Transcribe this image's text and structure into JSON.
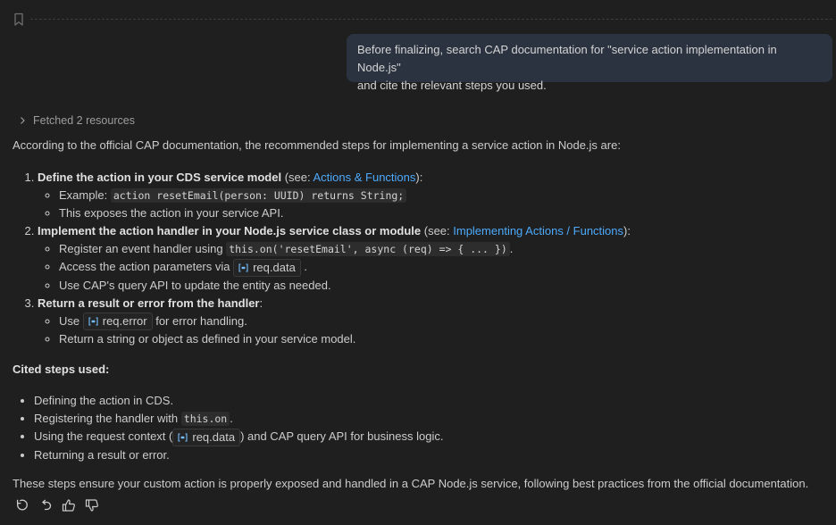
{
  "user_message": {
    "line1": "Before finalizing, search CAP documentation for \"service action implementation in Node.js\"",
    "line2": "and cite the relevant steps you used."
  },
  "fetched": {
    "label": "Fetched 2 resources"
  },
  "response": {
    "intro": "According to the official CAP documentation, the recommended steps for implementing a service action in Node.js are:",
    "step1": {
      "title": "Define the action in your CDS service model",
      "see": " (see: ",
      "link": "Actions & Functions",
      "end": "):",
      "sub1_prefix": "Example: ",
      "sub1_code": "action resetEmail(person: UUID) returns String;",
      "sub2": "This exposes the action in your service API."
    },
    "step2": {
      "title": "Implement the action handler in your Node.js service class or module",
      "see": " (see: ",
      "link": "Implementing Actions / Functions",
      "end": "):",
      "sub1_prefix": "Register an event handler using ",
      "sub1_code": "this.on('resetEmail', async (req) => { ... })",
      "sub1_end": ".",
      "sub2_prefix": "Access the action parameters via ",
      "sub2_sym": "req.data",
      "sub2_end": ".",
      "sub3": "Use CAP's query API to update the entity as needed."
    },
    "step3": {
      "title": "Return a result or error from the handler",
      "end": ":",
      "sub1_prefix": "Use ",
      "sub1_sym": "req.error",
      "sub1_end": " for error handling.",
      "sub2": "Return a string or object as defined in your service model."
    },
    "cited_heading": "Cited steps used:",
    "cited": {
      "item1": "Defining the action in CDS.",
      "item2_prefix": "Registering the handler with ",
      "item2_code": "this.on",
      "item2_end": ".",
      "item3_prefix": "Using the request context (",
      "item3_sym": "req.data",
      "item3_end": ") and CAP query API for business logic.",
      "item4": "Returning a result or error."
    },
    "closing": "These steps ensure your custom action is properly exposed and handled in a CAP Node.js service, following best practices from the official documentation."
  },
  "icons": {
    "bookmark": "bookmark-icon",
    "chevron": "chevron-right-icon",
    "symbol": "symbol-variable-icon",
    "retry": "retry-icon",
    "undo": "undo-icon",
    "thumbs_up": "thumbs-up-icon",
    "thumbs_down": "thumbs-down-icon"
  },
  "colors": {
    "background": "#1f1f1f",
    "bubble": "#2b3340",
    "link": "#4daafc",
    "text": "#cccccc"
  }
}
